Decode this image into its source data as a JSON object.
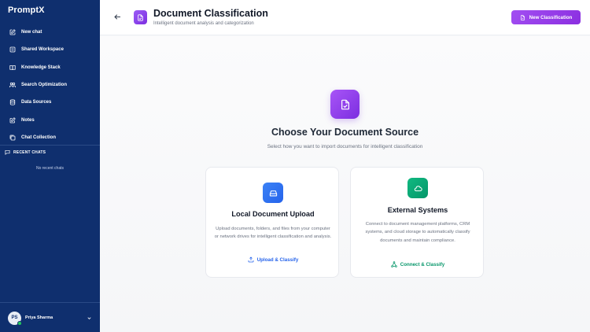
{
  "app": {
    "name": "PromptX"
  },
  "sidebar": {
    "items": [
      {
        "label": "New chat",
        "icon": "edit-icon"
      },
      {
        "label": "Shared Workspace",
        "icon": "share-icon"
      },
      {
        "label": "Knowledge Stack",
        "icon": "book-icon"
      },
      {
        "label": "Search Optimization",
        "icon": "users-icon"
      },
      {
        "label": "Data Sources",
        "icon": "database-icon"
      },
      {
        "label": "Notes",
        "icon": "pencil-square-icon"
      },
      {
        "label": "Chat Collection",
        "icon": "chat-collection-icon"
      }
    ],
    "recent_heading": "RECENT CHATS",
    "recent_empty": "No recent chats",
    "user": {
      "initials": "PS",
      "name": "Priya Sharma"
    }
  },
  "header": {
    "title": "Document Classification",
    "subtitle": "Intelligent document analysis and categorization",
    "new_button": "New Classification"
  },
  "main": {
    "title": "Choose Your Document Source",
    "subtitle": "Select how you want to import documents for intelligent classification",
    "cards": [
      {
        "title": "Local Document Upload",
        "description": "Upload documents, folders, and files from your computer or network drives for intelligent classification and analysis.",
        "action": "Upload & Classify"
      },
      {
        "title": "External Systems",
        "description": "Connect to document management platforms, CRM systems, and cloud storage to automatically classify documents and maintain compliance.",
        "action": "Connect & Classify"
      }
    ]
  },
  "colors": {
    "sidebar_bg": "#0f2f6e",
    "accent_purple": "#8b2fe0",
    "upload_blue": "#2563eb",
    "connect_green": "#059669"
  }
}
